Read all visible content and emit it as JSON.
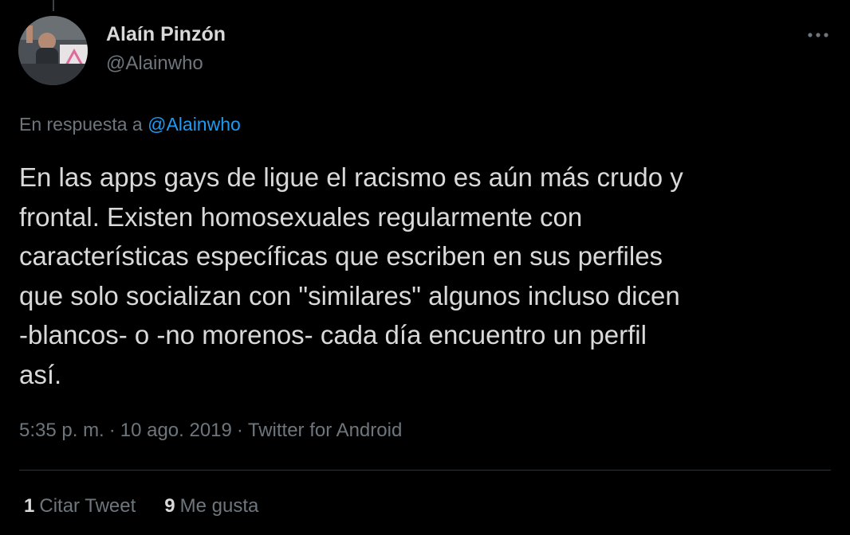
{
  "author": {
    "display_name": "Alaín Pinzón",
    "handle": "@Alainwho",
    "avatar_icon": "profile-photo"
  },
  "reply": {
    "prefix": "En respuesta a",
    "mention": "@Alainwho"
  },
  "tweet": {
    "text": "En las apps gays de ligue el racismo es aún más crudo y\nfrontal. Existen homosexuales regularmente con\ncaracterísticas específicas que escriben en sus perfiles\nque solo socializan con \"similares\" algunos incluso dicen\n-blancos- o -no morenos- cada día encuentro un perfil\nasí."
  },
  "meta": {
    "time": "5:35 p. m.",
    "separator": "·",
    "date": "10 ago. 2019",
    "source": "Twitter for Android"
  },
  "stats": {
    "quotes_count": "1",
    "quotes_label": "Citar Tweet",
    "likes_count": "9",
    "likes_label": "Me gusta"
  },
  "colors": {
    "background": "#000000",
    "text": "#D9D9D9",
    "secondary": "#6E767D",
    "link": "#1D9BF0",
    "divider": "#2F3336"
  },
  "icons": {
    "more": "more-horizontal-icon"
  }
}
